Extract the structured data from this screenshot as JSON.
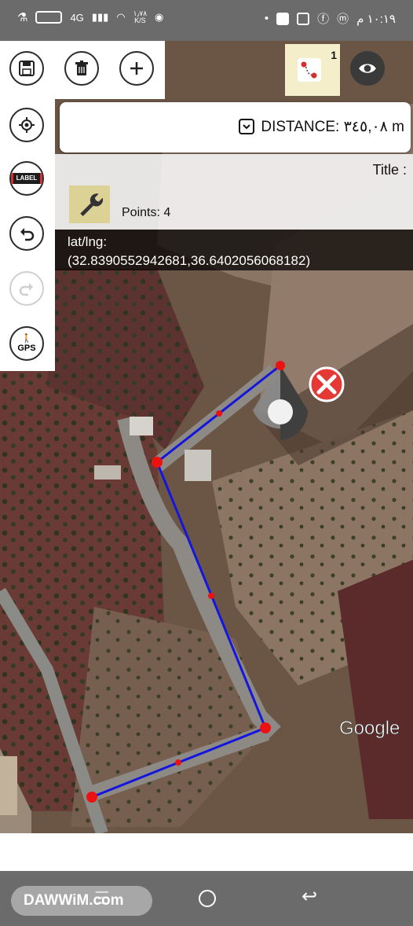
{
  "status_bar": {
    "time": "١٠:١٩ م",
    "network": "4G",
    "speed": "١٫٧٨",
    "speed_unit": "K/S"
  },
  "toolbar": {
    "save_icon": "floppy-disk-icon",
    "delete_icon": "trash-icon",
    "add_icon": "plus-icon",
    "route_badge": "1",
    "view_icon": "eye-icon"
  },
  "side_tools": {
    "locate_icon": "crosshair-icon",
    "label_text": "LABEL",
    "undo_icon": "undo-icon",
    "redo_icon": "redo-icon",
    "gps_text": "GPS"
  },
  "distance": {
    "label": "DISTANCE: ٣٤٥,٠٨ m"
  },
  "info": {
    "title_label": "Title :",
    "points": "Points: 4",
    "settings_icon": "wrench-icon"
  },
  "coords": {
    "line1": "lat/lng:",
    "line2": "(32.8390552942681,36.6402056068182)"
  },
  "map": {
    "attribution": "Google",
    "route_color": "#1515e0",
    "point_color": "#ee1111",
    "delete_marker_color": "#e53935"
  },
  "nav_bar": {
    "watermark": "DAWWiM.com"
  }
}
